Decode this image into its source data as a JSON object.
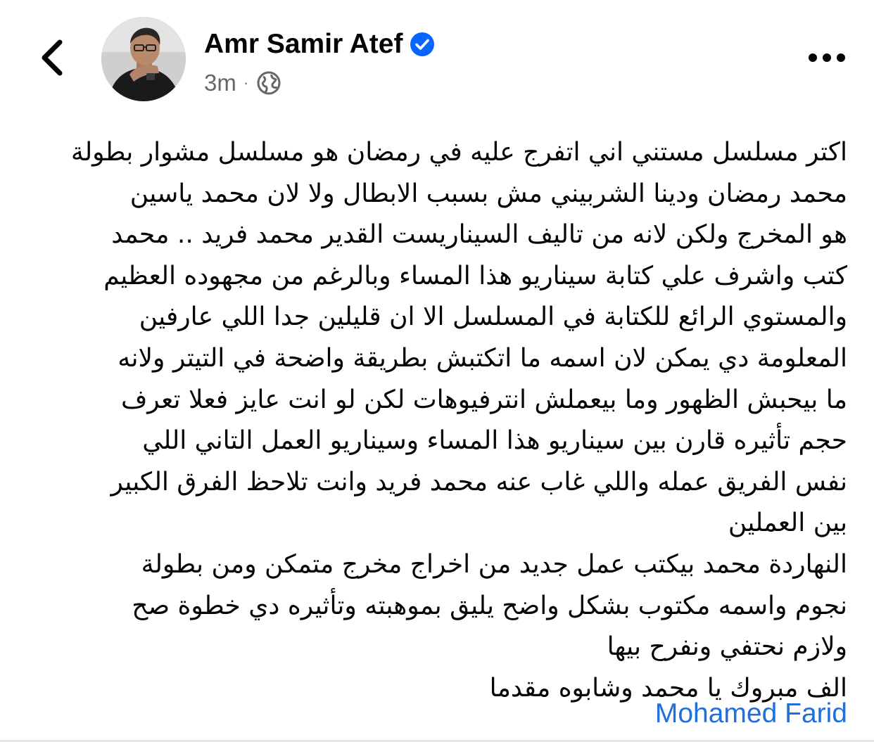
{
  "post": {
    "author": "Amr Samir Atef",
    "verified": true,
    "time": "3m",
    "separator": "·",
    "audience_icon": "globe-icon",
    "body_lines": [
      "اكتر مسلسل مستني اني اتفرج عليه في رمضان هو مسلسل مشوار بطولة",
      "محمد رمضان ودينا الشربيني مش بسبب الابطال ولا لان محمد ياسين",
      "هو المخرج ولكن لانه من تاليف السيناريست القدير محمد فريد .. محمد",
      "كتب واشرف علي كتابة  سيناريو هذا المساء وبالرغم من مجهوده العظيم",
      "والمستوي الرائع للكتابة في المسلسل الا ان قليلين جدا اللي عارفين",
      "المعلومة دي يمكن لان اسمه ما اتكتبش بطريقة واضحة في التيتر ولانه",
      "ما بيحبش الظهور وما بيعملش انترفيوهات لكن  لو انت عايز فعلا تعرف",
      "حجم تأثيره قارن بين سيناريو هذا المساء وسيناريو العمل التاني اللي",
      "نفس الفريق عمله واللي غاب عنه محمد فريد وانت تلاحظ الفرق الكبير",
      "بين العملين",
      "النهاردة محمد بيكتب عمل جديد من اخراج مخرج متمكن ومن بطولة",
      "نجوم واسمه مكتوب بشكل واضح يليق بموهبته وتأثيره دي خطوة صح",
      "ولازم نحتفي ونفرح بيها",
      "الف مبروك يا محمد وشابوه مقدما"
    ],
    "tagged_user": "Mohamed Farid"
  },
  "colors": {
    "text": "#050505",
    "meta": "#65676b",
    "link": "#216fdb",
    "verified_badge": "#0866ff"
  },
  "icons": {
    "back": "chevron-left-icon",
    "more": "more-horizontal-icon",
    "verified": "verified-badge-icon"
  }
}
